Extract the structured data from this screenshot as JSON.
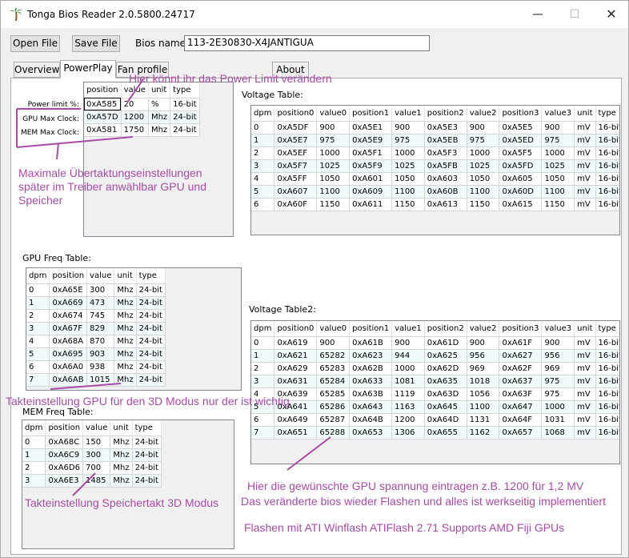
{
  "app": {
    "title": "Tonga Bios Reader 2.0.5800.24717",
    "icon": "palm-tree-icon"
  },
  "window_controls": {
    "minimize": "—",
    "maximize": "☐",
    "close": "✕"
  },
  "toolbar": {
    "open_label": "Open File",
    "save_label": "Save File",
    "bios_name_label": "Bios name:",
    "bios_name_value": "113-2E30830-X4JANTIGUA"
  },
  "tabs": [
    {
      "label": "Overview"
    },
    {
      "label": "PowerPlay",
      "active": true
    },
    {
      "label": "Fan profile"
    },
    {
      "label": "About"
    }
  ],
  "powerplay": {
    "labels": [
      "Power limit %:",
      "GPU Max Clock:",
      "MEM Max Clock:"
    ],
    "columns": [
      "position",
      "value",
      "unit",
      "type"
    ],
    "rows": [
      [
        "0xA585",
        "20",
        "%",
        "16-bit"
      ],
      [
        "0xA57D",
        "1200",
        "Mhz",
        "24-bit"
      ],
      [
        "0xA581",
        "1750",
        "Mhz",
        "24-bit"
      ]
    ]
  },
  "voltage_table": {
    "label": "Voltage Table:",
    "columns": [
      "dpm",
      "position0",
      "value0",
      "position1",
      "value1",
      "position2",
      "value2",
      "position3",
      "value3",
      "unit",
      "type"
    ],
    "rows": [
      [
        "0",
        "0xA5DF",
        "900",
        "0xA5E1",
        "900",
        "0xA5E3",
        "900",
        "0xA5E5",
        "900",
        "mV",
        "16-bit"
      ],
      [
        "1",
        "0xA5E7",
        "975",
        "0xA5E9",
        "975",
        "0xA5EB",
        "975",
        "0xA5ED",
        "975",
        "mV",
        "16-bit"
      ],
      [
        "2",
        "0xA5EF",
        "1000",
        "0xA5F1",
        "1000",
        "0xA5F3",
        "1000",
        "0xA5F5",
        "1000",
        "mV",
        "16-bit"
      ],
      [
        "3",
        "0xA5F7",
        "1025",
        "0xA5F9",
        "1025",
        "0xA5FB",
        "1025",
        "0xA5FD",
        "1025",
        "mV",
        "16-bit"
      ],
      [
        "4",
        "0xA5FF",
        "1050",
        "0xA601",
        "1050",
        "0xA603",
        "1050",
        "0xA605",
        "1050",
        "mV",
        "16-bit"
      ],
      [
        "5",
        "0xA607",
        "1100",
        "0xA609",
        "1100",
        "0xA60B",
        "1100",
        "0xA60D",
        "1100",
        "mV",
        "16-bit"
      ],
      [
        "6",
        "0xA60F",
        "1150",
        "0xA611",
        "1150",
        "0xA613",
        "1150",
        "0xA615",
        "1150",
        "mV",
        "16-bit"
      ]
    ]
  },
  "gpu_freq_table": {
    "label": "GPU Freq Table:",
    "columns": [
      "dpm",
      "position",
      "value",
      "unit",
      "type"
    ],
    "rows": [
      [
        "0",
        "0xA65E",
        "300",
        "Mhz",
        "24-bit"
      ],
      [
        "1",
        "0xA669",
        "473",
        "Mhz",
        "24-bit"
      ],
      [
        "2",
        "0xA674",
        "745",
        "Mhz",
        "24-bit"
      ],
      [
        "3",
        "0xA67F",
        "829",
        "Mhz",
        "24-bit"
      ],
      [
        "4",
        "0xA68A",
        "870",
        "Mhz",
        "24-bit"
      ],
      [
        "5",
        "0xA695",
        "903",
        "Mhz",
        "24-bit"
      ],
      [
        "6",
        "0xA6A0",
        "938",
        "Mhz",
        "24-bit"
      ],
      [
        "7",
        "0xA6AB",
        "1015",
        "Mhz",
        "24-bit"
      ]
    ]
  },
  "voltage_table2": {
    "label": "Voltage Table2:",
    "columns": [
      "dpm",
      "position0",
      "value0",
      "position1",
      "value1",
      "position2",
      "value2",
      "position3",
      "value3",
      "unit",
      "type"
    ],
    "rows": [
      [
        "0",
        "0xA619",
        "900",
        "0xA61B",
        "900",
        "0xA61D",
        "900",
        "0xA61F",
        "900",
        "mV",
        "16-bit"
      ],
      [
        "1",
        "0xA621",
        "65282",
        "0xA623",
        "944",
        "0xA625",
        "956",
        "0xA627",
        "956",
        "mV",
        "16-bit"
      ],
      [
        "2",
        "0xA629",
        "65283",
        "0xA62B",
        "1000",
        "0xA62D",
        "969",
        "0xA62F",
        "969",
        "mV",
        "16-bit"
      ],
      [
        "3",
        "0xA631",
        "65284",
        "0xA633",
        "1081",
        "0xA635",
        "1018",
        "0xA637",
        "975",
        "mV",
        "16-bit"
      ],
      [
        "4",
        "0xA639",
        "65285",
        "0xA63B",
        "1119",
        "0xA63D",
        "1056",
        "0xA63F",
        "975",
        "mV",
        "16-bit"
      ],
      [
        "5",
        "0xA641",
        "65286",
        "0xA643",
        "1163",
        "0xA645",
        "1100",
        "0xA647",
        "1000",
        "mV",
        "16-bit"
      ],
      [
        "6",
        "0xA649",
        "65287",
        "0xA64B",
        "1200",
        "0xA64D",
        "1131",
        "0xA64F",
        "1031",
        "mV",
        "16-bit"
      ],
      [
        "7",
        "0xA651",
        "65288",
        "0xA653",
        "1306",
        "0xA655",
        "1162",
        "0xA657",
        "1068",
        "mV",
        "16-bit"
      ]
    ]
  },
  "mem_freq_table": {
    "label": "MEM Freq Table:",
    "columns": [
      "dpm",
      "position",
      "value",
      "unit",
      "type"
    ],
    "rows": [
      [
        "0",
        "0xA68C",
        "150",
        "Mhz",
        "24-bit"
      ],
      [
        "1",
        "0xA6C9",
        "300",
        "Mhz",
        "24-bit"
      ],
      [
        "2",
        "0xA6D6",
        "700",
        "Mhz",
        "24-bit"
      ],
      [
        "3",
        "0xA6E3",
        "1485",
        "Mhz",
        "24-bit"
      ]
    ]
  },
  "annotations": {
    "power_limit": "Hier könnt ihr das Power Limit verändern",
    "max_clock": "Maximale Übertaktungseinstellungen später im Treiber anwählbar GPU und Speicher",
    "gpu_clock": "Takteinstellung GPU  für den 3D Modus nur der ist wichtig",
    "mem_clock": "Takteinstellung Speichertakt 3D Modus",
    "voltage_line1": "Hier die  gewünschte GPU spannung eintragen z.B.  1200 für 1,2 MV",
    "voltage_line2": "Das veränderte bios wieder Flashen und alles ist werkseitig implementiert",
    "flash_tool": "Flashen mit ATI Winflash ATIFlash 2.71 Supports AMD Fiji GPUs",
    "color": "#a64ca6"
  }
}
